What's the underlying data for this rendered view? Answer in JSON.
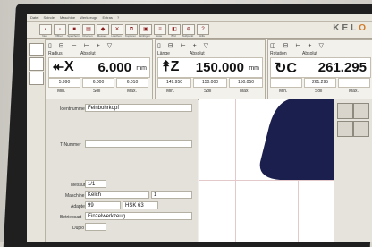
{
  "brand": {
    "text": "KEL",
    "suffix": "O"
  },
  "menu": [
    "Datei",
    "Spindel",
    "Maschine",
    "Werkzeuge",
    "Extras",
    "?"
  ],
  "toolbar": {
    "buttons": [
      "Neu",
      "Öffnen",
      "Speichern",
      "Drucken",
      "Messen",
      "Löschen",
      "Kopieren",
      "Einfügen",
      "Liste",
      "Bild",
      "Nullpunkt",
      "Hilfe"
    ]
  },
  "axes": [
    {
      "header_left": "Radius",
      "header_right": "Absolut",
      "letter": "X",
      "value": "6.000",
      "unit": "mm",
      "sub": [
        "5.990",
        "6.000",
        "6.010"
      ],
      "sub_labels": [
        "Min.",
        "Soll",
        "Max."
      ]
    },
    {
      "header_left": "Länge",
      "header_right": "Absolut",
      "letter": "Z",
      "value": "150.000",
      "unit": "mm",
      "sub": [
        "149.950",
        "150.000",
        "150.050"
      ],
      "sub_labels": [
        "Min.",
        "Soll",
        "Max."
      ]
    },
    {
      "header_left": "Rotation",
      "header_right": "Absolut",
      "letter": "C",
      "value": "261.295",
      "unit": "",
      "sub": [
        "",
        "261.295",
        ""
      ],
      "sub_labels": [
        "Min.",
        "Soll",
        "Max."
      ]
    }
  ],
  "form": {
    "ident_label": "Identnummer",
    "ident_value": "Feinbohrkopf",
    "t_label": "T-Nummer",
    "t_value": "",
    "messung_label": "Messung",
    "messung_value": "1/1",
    "maschine_label": "Maschine",
    "maschine_value": "Kelch",
    "maschine_extra": "1",
    "adapter_label": "Adapter",
    "adapter_value": "99",
    "adapter_extra": "HSK 63",
    "betriebsart_label": "Betriebsart",
    "betriebsart_value": "Einzelwerkzeug",
    "duplo_label": "Duplo",
    "duplo_value": ""
  },
  "colors": {
    "tool_fill": "#1b1f4d",
    "accent": "#d07a2a"
  }
}
